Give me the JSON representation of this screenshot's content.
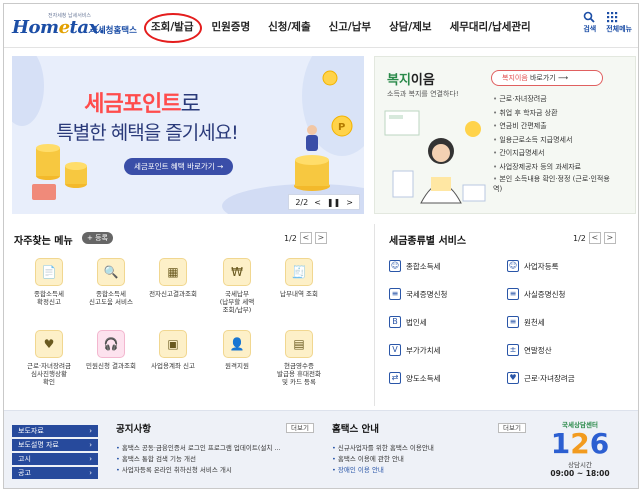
{
  "header": {
    "logo_small": "전자세청 납세서비스",
    "logo_main_a": "Hom",
    "logo_main_b": "e",
    "logo_main_c": "tax.",
    "logo_sub": "국세청홈택스",
    "menu": [
      "조회/발급",
      "민원증명",
      "신청/제출",
      "신고/납부",
      "상담/제보",
      "세무대리/납세관리"
    ],
    "search_label": "검색",
    "allmenu_label": "전체메뉴"
  },
  "hero": {
    "title_highlight": "세금포인트",
    "title_rest": "로",
    "subtitle": "특별한 혜택을 즐기세요!",
    "cta": "세금포인트 혜택 바로가기 →",
    "page": "2/2"
  },
  "welfare": {
    "title_a": "복지",
    "title_b": "이음",
    "desc": "소득과 복지를 연결하다!",
    "btn_hl": "복지이음",
    "btn_rest": " 바로가기",
    "items": [
      "근로·자녀장려금",
      "취업 후 학자금 상환",
      "연금비 간편제출",
      "일용근로소득 지급명세서",
      "간이지급명세서",
      "사업장제공자 등의 과세자료",
      "본인 소득내용 확인·정정 (근로·인적용역)"
    ]
  },
  "favorites": {
    "title": "자주찾는 메뉴",
    "register": "+ 등록",
    "page": "1/2",
    "items": [
      {
        "label": "종합소득세\n확정신고",
        "icon": "doc-icon"
      },
      {
        "label": "종합소득세\n신고도움 서비스",
        "icon": "search-doc-icon"
      },
      {
        "label": "전자신고결과조회",
        "icon": "result-icon"
      },
      {
        "label": "국세납부\n(납부할 세액\n조회/납부)",
        "icon": "pay-icon"
      },
      {
        "label": "납부내역 조회",
        "icon": "receipt-icon"
      },
      {
        "label": "근로·자녀장려금\n심사진행상황\n확인",
        "icon": "heart-icon"
      },
      {
        "label": "민원신청 결과조회",
        "icon": "headset-icon"
      },
      {
        "label": "사업용계좌 신고",
        "icon": "account-icon"
      },
      {
        "label": "원격지원",
        "icon": "remote-icon"
      },
      {
        "label": "현금영수증\n발급용 휴대전화\n및 카드 등록",
        "icon": "card-icon"
      }
    ]
  },
  "services": {
    "title": "세금종류별 서비스",
    "page": "1/2",
    "items": [
      {
        "label": "종합소득세",
        "icon": "people-icon"
      },
      {
        "label": "사업자등록",
        "icon": "person-icon"
      },
      {
        "label": "국세증명신청",
        "icon": "cert-icon"
      },
      {
        "label": "사실증명신청",
        "icon": "fact-icon"
      },
      {
        "label": "법인세",
        "icon": "corp-icon"
      },
      {
        "label": "원천세",
        "icon": "withhold-icon"
      },
      {
        "label": "부가가치세",
        "icon": "vat-icon"
      },
      {
        "label": "연말정산",
        "icon": "calc-icon"
      },
      {
        "label": "양도소득세",
        "icon": "transfer-icon"
      },
      {
        "label": "근로·자녀장려금",
        "icon": "heart-icon"
      }
    ]
  },
  "footer": {
    "quick": [
      "보도자료",
      "보도설명 자료",
      "고시",
      "공고"
    ],
    "notice_title": "공지사항",
    "notice_more": "더보기",
    "notices": [
      "홈택스 공동·금융인증서 로그인 프로그램 업데이트(설치 ...",
      "홈택스 통합 검색 기능 개선",
      "사업자등록 온라인 취하신청 서비스 개시"
    ],
    "guide_title": "홈택스 안내",
    "guide_more": "더보기",
    "guides": [
      "신규사업자를 위한 홈택스 이용안내",
      "홈택스 이용에 관한 안내",
      "장애인 이용 안내"
    ],
    "call_top": "국세상담센터",
    "call_num_a": "1",
    "call_num_b": "2",
    "call_num_c": "6",
    "call_caption": "상담시간",
    "call_time": "09:00 ~ 18:00"
  }
}
